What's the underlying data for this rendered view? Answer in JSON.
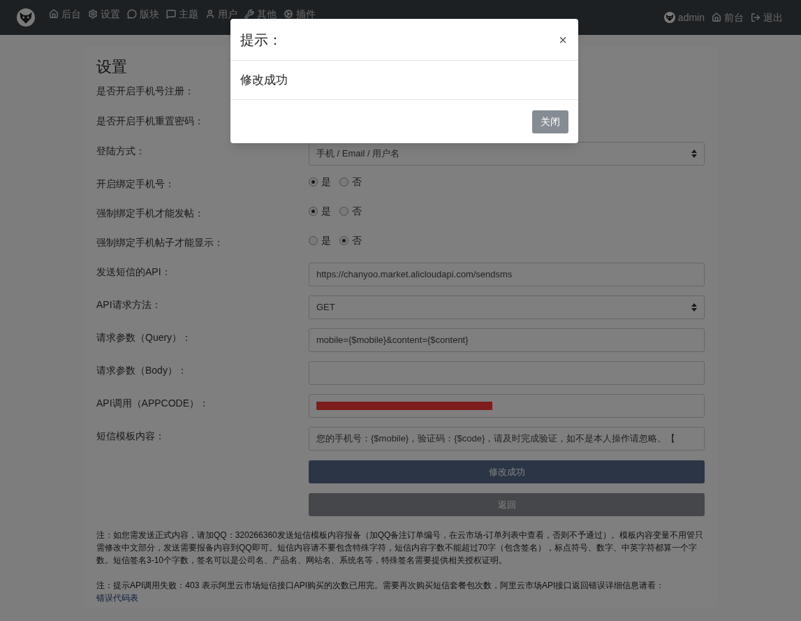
{
  "navbar": {
    "left": [
      {
        "kind": "home",
        "label": "后台"
      },
      {
        "kind": "cog",
        "label": "设置"
      },
      {
        "kind": "comments",
        "label": "版块"
      },
      {
        "kind": "comment",
        "label": "主题"
      },
      {
        "kind": "user",
        "label": "用户"
      },
      {
        "kind": "wrench",
        "label": "其他"
      },
      {
        "kind": "cogs",
        "label": "插件"
      }
    ],
    "right": [
      {
        "kind": "avatar",
        "label": "admin"
      },
      {
        "kind": "home",
        "label": "前台"
      },
      {
        "kind": "logout",
        "label": "退出"
      }
    ]
  },
  "card": {
    "title": "设置",
    "rows": [
      {
        "kind": "label",
        "label": "是否开启手机号注册："
      },
      {
        "kind": "label",
        "label": "是否开启手机重置密码："
      },
      {
        "kind": "select",
        "label": "登陆方式：",
        "value": "手机 / Email / 用户名"
      },
      {
        "kind": "radio",
        "label": "开启绑定手机号：",
        "options": [
          {
            "label": "是",
            "selected": true
          },
          {
            "label": "否",
            "selected": false
          }
        ]
      },
      {
        "kind": "radio",
        "label": "强制绑定手机才能发帖：",
        "options": [
          {
            "label": "是",
            "selected": true
          },
          {
            "label": "否",
            "selected": false
          }
        ]
      },
      {
        "kind": "radio",
        "label": "强制绑定手机帖子才能显示：",
        "options": [
          {
            "label": "是",
            "selected": false
          },
          {
            "label": "否",
            "selected": true
          }
        ]
      },
      {
        "kind": "text",
        "label": "发送短信的API：",
        "value": "https://chanyoo.market.alicloudapi.com/sendsms"
      },
      {
        "kind": "select",
        "label": "API请求方法：",
        "value": "GET"
      },
      {
        "kind": "text",
        "label": "请求参数（Query）：",
        "value": "mobile={$mobile}&content={$content}"
      },
      {
        "kind": "text",
        "label": "请求参数（Body）："
      },
      {
        "kind": "redacted",
        "label": "API调用（APPCODE）："
      },
      {
        "kind": "text",
        "label": "短信模板内容：",
        "value": "您的手机号：{$mobile}，验证码：{$code}，请及时完成验证，如不是本人操作请忽略。【"
      }
    ],
    "buttons": [
      {
        "kind": "primary",
        "label": "修改成功"
      },
      {
        "kind": "secondary",
        "label": "返回"
      }
    ],
    "notes": [
      {
        "text": "注：如您需发送正式内容，请加QQ：320266360发送短信模板内容报备（加QQ备注订单编号，在云市场-订单列表中查看，否则不予通过）。模板内容变量不用管只需修改中文部分，发送需要报备内容到QQ即可。短信内容请不要包含特殊字符，短信内容字数不能超过70字（包含签名），标点符号、数字、中英字符都算一个字数。短信签名3-10个字数，签名可以是公司名、产品名、网站名、系统名等，特殊签名需要提供相关授权证明。"
      },
      {
        "text": "注：提示API调用失败：403 表示阿里云市场短信接口API购买的次数已用完。需要再次购买短信套餐包次数，阿里云市场API接口返回错误详细信息请看：",
        "link": "错误代码表"
      }
    ]
  },
  "modal": {
    "title": "提示：",
    "close": "×",
    "body": "修改成功",
    "button": "关闭"
  }
}
